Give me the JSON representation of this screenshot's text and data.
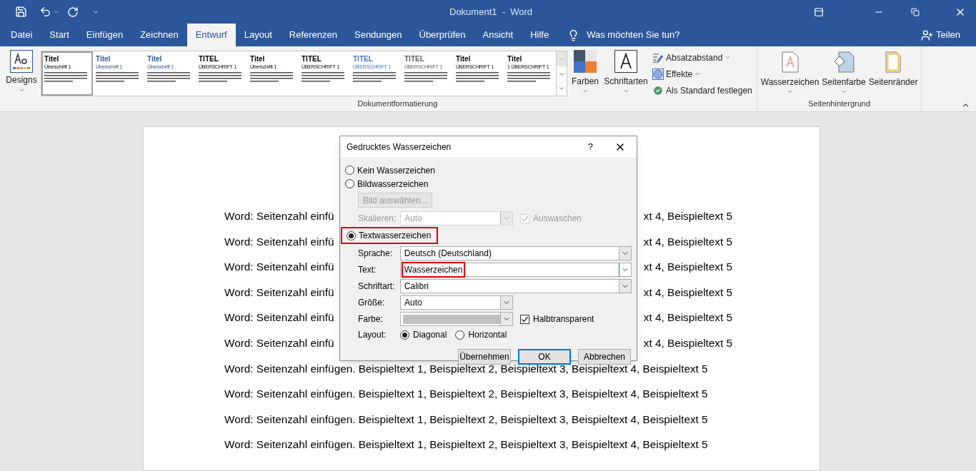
{
  "window": {
    "title": "Dokument1  -  Word"
  },
  "tabs": [
    {
      "label": "Datei",
      "selected": false
    },
    {
      "label": "Start",
      "selected": false
    },
    {
      "label": "Einfügen",
      "selected": false
    },
    {
      "label": "Zeichnen",
      "selected": false
    },
    {
      "label": "Entwurf",
      "selected": true
    },
    {
      "label": "Layout",
      "selected": false
    },
    {
      "label": "Referenzen",
      "selected": false
    },
    {
      "label": "Sendungen",
      "selected": false
    },
    {
      "label": "Überprüfen",
      "selected": false
    },
    {
      "label": "Ansicht",
      "selected": false
    },
    {
      "label": "Hilfe",
      "selected": false
    }
  ],
  "tell_me": "Was möchten Sie tun?",
  "share": "Teilen",
  "ribbon": {
    "designs": "Designs",
    "gallery": [
      {
        "title": "Titel",
        "heading": "Überschrift 1",
        "color": "#000000",
        "selected": true
      },
      {
        "title": "Titel",
        "heading": "Überschrift 1",
        "color": "#2f5496",
        "selected": false
      },
      {
        "title": "Titel",
        "heading": "Überschrift 1",
        "color": "#2f5496",
        "selected": false
      },
      {
        "title": "TITEL",
        "heading": "ÜBERSCHRIFT 1",
        "color": "#000000",
        "selected": false
      },
      {
        "title": "Titel",
        "heading": "Überschrift 1",
        "color": "#000000",
        "selected": false
      },
      {
        "title": "TITEL",
        "heading": "ÜBERSCHRIFT 1",
        "color": "#000000",
        "selected": false
      },
      {
        "title": "TITEL",
        "heading": "ÜBERSCHRIFT 1",
        "color": "#4472c4",
        "selected": false
      },
      {
        "title": "TITEL",
        "heading": "ÜBERSCHRIFT 1",
        "color": "#595959",
        "selected": false
      },
      {
        "title": "Titel",
        "heading": "ÜBERSCHRIFT 1",
        "color": "#000000",
        "selected": false
      },
      {
        "title": "Titel",
        "heading": "1 ÜBERSCHRIFT 1",
        "color": "#000000",
        "selected": false
      }
    ],
    "farben": "Farben",
    "schriftarten": "Schriftarten",
    "small_buttons": [
      {
        "label": "Absatzabstand",
        "kind": "spacing",
        "dropdown": true
      },
      {
        "label": "Effekte",
        "kind": "effects",
        "dropdown": true
      },
      {
        "label": "Als Standard festlegen",
        "kind": "default",
        "dropdown": false
      }
    ],
    "group_1": "Dokumentformatierung",
    "background_buttons": [
      {
        "label": "Wasserzeichen",
        "kind": "watermark",
        "dropdown": true
      },
      {
        "label": "Seitenfarbe",
        "kind": "pagecolor",
        "dropdown": true
      },
      {
        "label": "Seitenränder",
        "kind": "borders",
        "dropdown": false
      }
    ],
    "group_2": "Seitenhintergrund"
  },
  "document": {
    "lines": [
      {
        "left": "Word: Seitenzahl einfü",
        "right": "xt 4, Beispieltext 5"
      },
      {
        "left": "Word: Seitenzahl einfü",
        "right": "xt 4, Beispieltext 5"
      },
      {
        "left": "Word: Seitenzahl einfü",
        "right": "xt 4, Beispieltext 5"
      },
      {
        "left": "Word: Seitenzahl einfü",
        "right": "xt 4, Beispieltext 5"
      },
      {
        "left": "Word: Seitenzahl einfü",
        "right": "xt 4, Beispieltext 5"
      },
      {
        "left": "Word: Seitenzahl einfü",
        "right": "xt 4, Beispieltext 5"
      },
      {
        "text": "Word: Seitenzahl einfügen. Beispieltext 1, Beispieltext 2, Beispieltext 3, Beispieltext 4, Beispieltext 5"
      },
      {
        "text": "Word: Seitenzahl einfügen. Beispieltext 1, Beispieltext 2, Beispieltext 3, Beispieltext 4, Beispieltext 5"
      },
      {
        "text": "Word: Seitenzahl einfügen. Beispieltext 1, Beispieltext 2, Beispieltext 3, Beispieltext 4, Beispieltext 5"
      },
      {
        "text": "Word: Seitenzahl einfügen. Beispieltext 1, Beispieltext 2, Beispieltext 3, Beispieltext 4, Beispieltext 5"
      }
    ]
  },
  "dialog": {
    "title": "Gedrucktes Wasserzeichen",
    "help": "?",
    "no_watermark": {
      "label": "Kein Wasserzeichen",
      "selected": false
    },
    "picture_watermark": {
      "label": "Bildwasserzeichen",
      "selected": false
    },
    "select_picture": {
      "label": "Bild auswählen...",
      "disabled": true
    },
    "scale": {
      "label": "Skalieren:",
      "value": "Auto",
      "disabled": true
    },
    "washout": {
      "label": "Auswaschen",
      "checked": true,
      "disabled": true
    },
    "text_watermark": {
      "label": "Textwasserzeichen",
      "selected": true,
      "highlighted": true
    },
    "language": {
      "label": "Sprache:",
      "value": "Deutsch (Deutschland)"
    },
    "text": {
      "label": "Text:",
      "value": "Wasserzeichen",
      "highlighted": true
    },
    "font": {
      "label": "Schriftart:",
      "value": "Calibri"
    },
    "size": {
      "label": "Größe:",
      "value": "Auto"
    },
    "color": {
      "label": "Farbe:"
    },
    "semitransparent": {
      "label": "Halbtransparent",
      "checked": true
    },
    "layout": {
      "label": "Layout:",
      "options": [
        {
          "label": "Diagonal",
          "selected": true
        },
        {
          "label": "Horizontal",
          "selected": false
        }
      ]
    },
    "buttons": [
      {
        "label": "Übernehmen",
        "default": false
      },
      {
        "label": "OK",
        "default": true
      },
      {
        "label": "Abbrechen",
        "default": false
      }
    ]
  }
}
